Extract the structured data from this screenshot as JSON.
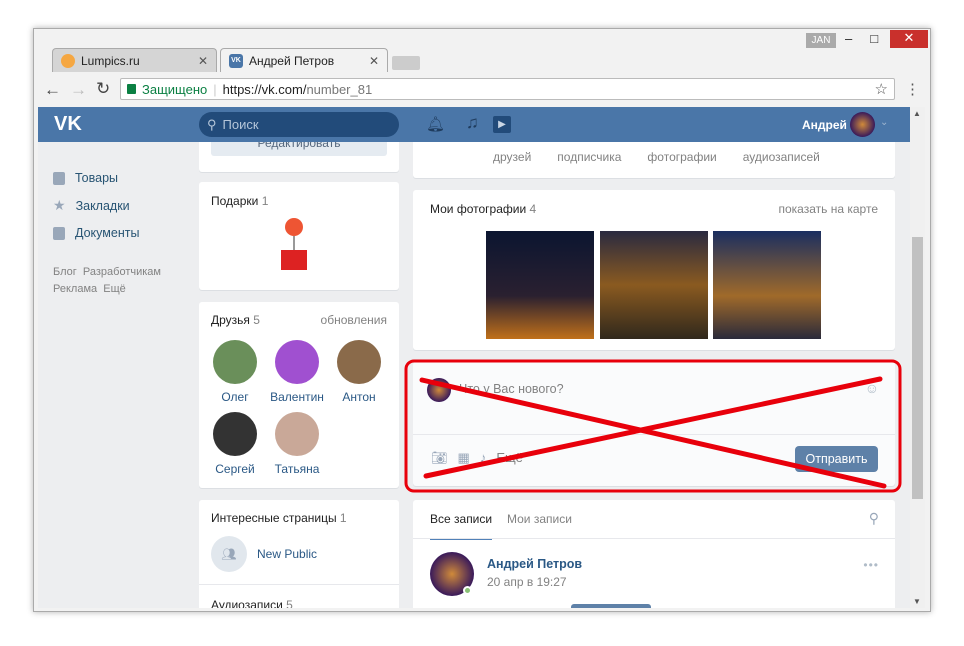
{
  "browser": {
    "tabs": [
      {
        "label": "Lumpics.ru"
      },
      {
        "label": "Андрей Петров"
      }
    ],
    "user_badge": "JAN",
    "secure_label": "Защищено",
    "url_host": "https://vk.com/",
    "url_path": "number_81"
  },
  "header": {
    "search_placeholder": "Поиск",
    "user_name": "Андрей"
  },
  "left_nav": {
    "items": [
      {
        "label": "Товары"
      },
      {
        "label": "Закладки"
      },
      {
        "label": "Документы"
      }
    ],
    "footer_links": [
      "Блог",
      "Разработчикам",
      "Реклама",
      "Ещё"
    ]
  },
  "profile": {
    "edit_label": "Редактировать",
    "counters": [
      "друзей",
      "подписчика",
      "фотографии",
      "аудиозаписей"
    ]
  },
  "gifts": {
    "title": "Подарки",
    "count": "1"
  },
  "friends": {
    "title": "Друзья",
    "count": "5",
    "updates_link": "обновления",
    "list": [
      {
        "name": "Олег",
        "color": "#6a8f5a"
      },
      {
        "name": "Валентин",
        "color": "#a050d0"
      },
      {
        "name": "Антон",
        "color": "#8a6a4a"
      },
      {
        "name": "Сергей",
        "color": "#333333"
      },
      {
        "name": "Татьяна",
        "color": "#c9a898"
      }
    ]
  },
  "pages": {
    "title": "Интересные страницы",
    "count": "1",
    "items": [
      {
        "name": "New Public"
      }
    ]
  },
  "audio": {
    "title": "Аудиозаписи",
    "count": "5"
  },
  "photos": {
    "title": "Мои фотографии",
    "count": "4",
    "map_link": "показать на карте"
  },
  "composer": {
    "placeholder": "Что у Вас нового?",
    "more_label": "Ещё",
    "send_label": "Отправить"
  },
  "wall": {
    "tabs": [
      "Все записи",
      "Мои записи"
    ],
    "post": {
      "author": "Андрей Петров",
      "date": "20 апр в 19:27"
    }
  },
  "colors": {
    "vk_blue": "#4a76a8",
    "strike_red": "#e8000b"
  }
}
